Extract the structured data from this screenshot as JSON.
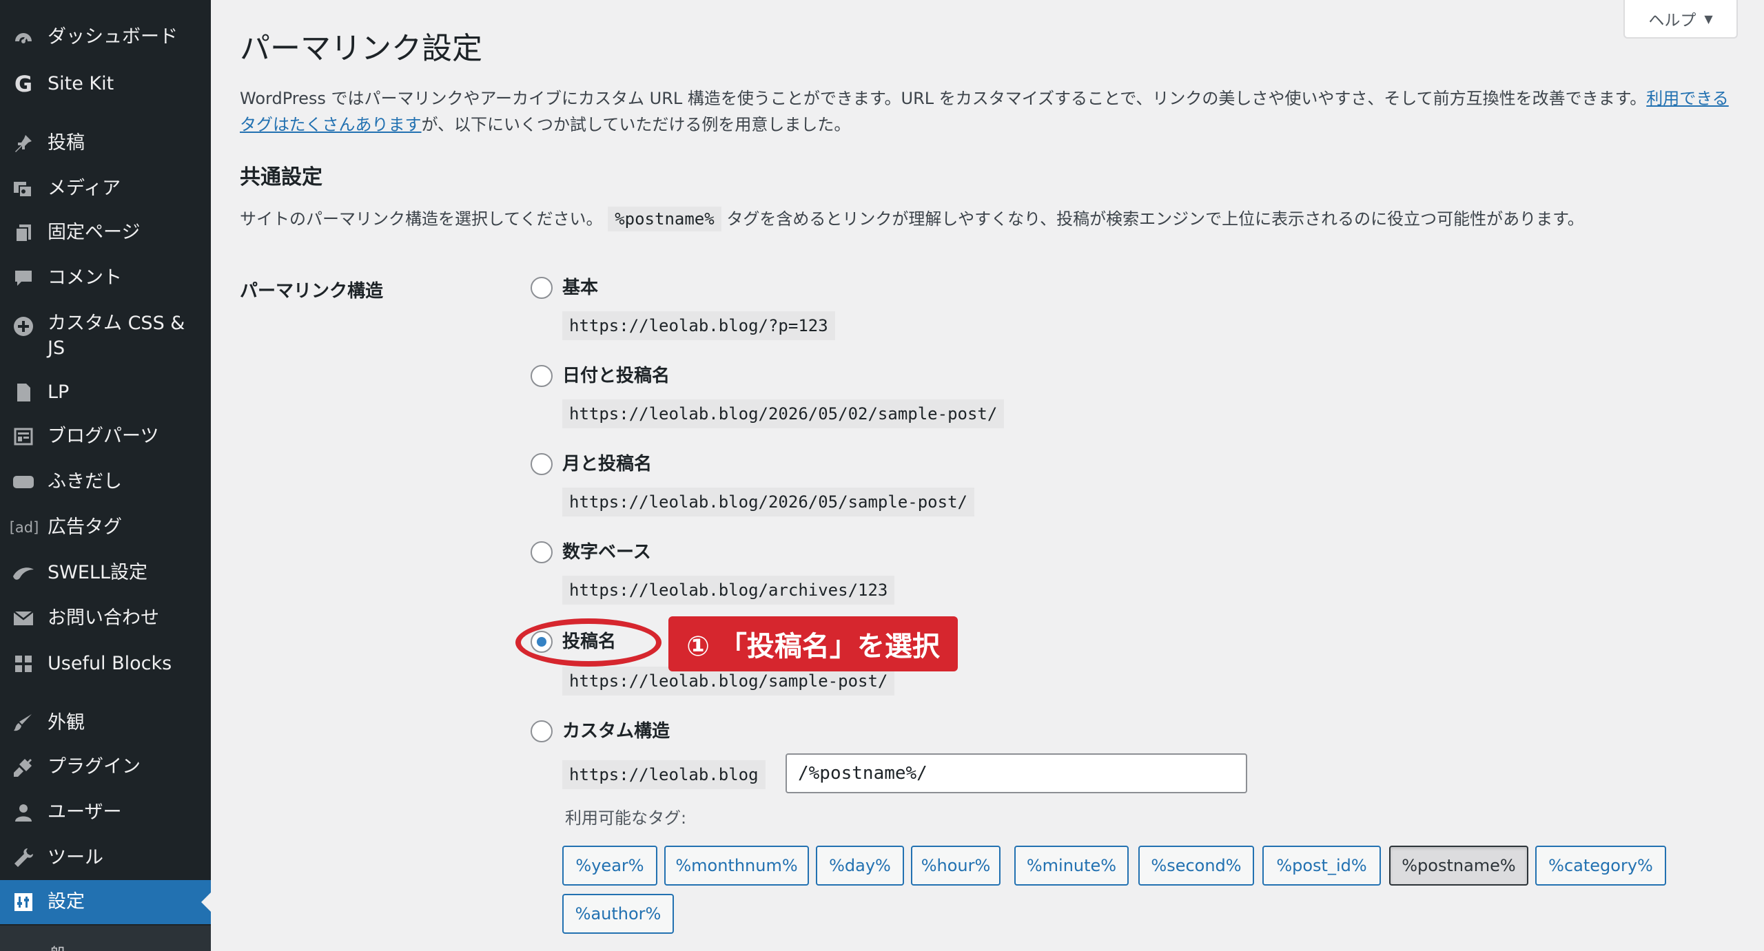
{
  "sidebar": {
    "items": [
      {
        "label": "ダッシュボード",
        "icon": "dashboard-icon"
      },
      {
        "label": "Site Kit",
        "icon": "google-g-icon"
      },
      {
        "label": "投稿",
        "icon": "pin-icon"
      },
      {
        "label": "メディア",
        "icon": "media-icon"
      },
      {
        "label": "固定ページ",
        "icon": "pages-icon"
      },
      {
        "label": "コメント",
        "icon": "comment-icon"
      },
      {
        "label": "カスタム CSS & JS",
        "icon": "plus-circle-icon"
      },
      {
        "label": "LP",
        "icon": "document-icon"
      },
      {
        "label": "ブログパーツ",
        "icon": "layout-icon"
      },
      {
        "label": "ふきだし",
        "icon": "speech-bubble-icon"
      },
      {
        "label": "広告タグ",
        "icon": "ad-icon",
        "icon_text": "[ad]"
      },
      {
        "label": "SWELL設定",
        "icon": "swell-icon"
      },
      {
        "label": "お問い合わせ",
        "icon": "mail-icon"
      },
      {
        "label": "Useful Blocks",
        "icon": "grid-icon"
      },
      {
        "label": "外観",
        "icon": "brush-icon"
      },
      {
        "label": "プラグイン",
        "icon": "plugin-icon"
      },
      {
        "label": "ユーザー",
        "icon": "user-icon"
      },
      {
        "label": "ツール",
        "icon": "wrench-icon"
      },
      {
        "label": "設定",
        "icon": "settings-icon",
        "active": true
      }
    ],
    "submenu_peek": "一般"
  },
  "help": {
    "label": "ヘルプ",
    "arrow": "▼"
  },
  "page": {
    "title": "パーマリンク設定",
    "intro_before": "WordPress ではパーマリンクやアーカイブにカスタム URL 構造を使うことができます。URL をカスタマイズすることで、リンクの美しさや使いやすさ、そして前方互換性を改善できます。",
    "intro_link": "利用できるタグはたくさんあります",
    "intro_after": "が、以下にいくつか試していただける例を用意しました。",
    "section_title": "共通設定",
    "section_desc_before": "サイトのパーマリンク構造を選択してください。",
    "section_desc_code": "%postname%",
    "section_desc_after": " タグを含めるとリンクが理解しやすくなり、投稿が検索エンジンで上位に表示されるのに役立つ可能性があります。",
    "row_label": "パーマリンク構造"
  },
  "options": [
    {
      "label": "基本",
      "example": "https://leolab.blog/?p=123",
      "checked": false
    },
    {
      "label": "日付と投稿名",
      "example": "https://leolab.blog/2026/05/02/sample-post/",
      "checked": false
    },
    {
      "label": "月と投稿名",
      "example": "https://leolab.blog/2026/05/sample-post/",
      "checked": false
    },
    {
      "label": "数字ベース",
      "example": "https://leolab.blog/archives/123",
      "checked": false
    },
    {
      "label": "投稿名",
      "example": "https://leolab.blog/sample-post/",
      "checked": true
    },
    {
      "label": "カスタム構造",
      "example": "https://leolab.blog",
      "checked": false
    }
  ],
  "custom_structure": {
    "value": "/%postname%/"
  },
  "available_tags": {
    "label": "利用可能なタグ:",
    "tags": [
      "%year%",
      "%monthnum%",
      "%day%",
      "%hour%",
      "%minute%",
      "%second%",
      "%post_id%",
      "%postname%",
      "%category%",
      "%author%"
    ],
    "pressed": "%postname%"
  },
  "annotation": {
    "text": "① 「投稿名」を選択",
    "color": "#d6262e"
  },
  "colors": {
    "sidebar_bg": "#1d2327",
    "accent": "#2271b1",
    "page_bg": "#f0f0f1"
  }
}
